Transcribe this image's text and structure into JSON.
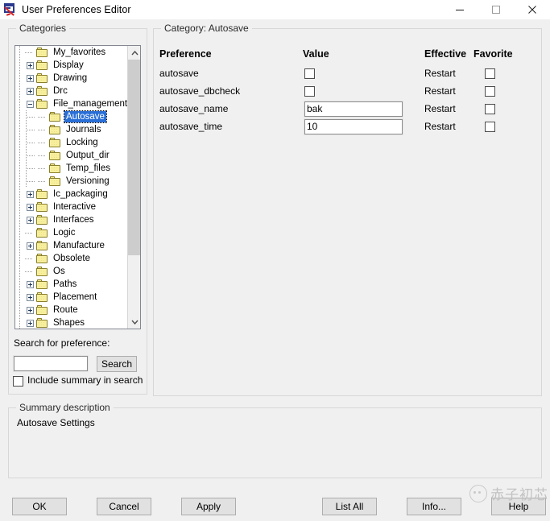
{
  "window": {
    "title": "User Preferences Editor",
    "icon": "app-icon",
    "buttons": {
      "minimize": "minimize-icon",
      "maximize": "maximize-icon",
      "close": "close-icon"
    }
  },
  "categories_panel": {
    "legend": "Categories",
    "tree": [
      {
        "label": "My_favorites",
        "indent": 1,
        "toggle": "none",
        "selected": false
      },
      {
        "label": "Display",
        "indent": 1,
        "toggle": "plus",
        "selected": false
      },
      {
        "label": "Drawing",
        "indent": 1,
        "toggle": "plus",
        "selected": false
      },
      {
        "label": "Drc",
        "indent": 1,
        "toggle": "plus",
        "selected": false
      },
      {
        "label": "File_management",
        "indent": 1,
        "toggle": "minus",
        "selected": false
      },
      {
        "label": "Autosave",
        "indent": 2,
        "toggle": "none",
        "selected": true
      },
      {
        "label": "Journals",
        "indent": 2,
        "toggle": "none",
        "selected": false
      },
      {
        "label": "Locking",
        "indent": 2,
        "toggle": "none",
        "selected": false
      },
      {
        "label": "Output_dir",
        "indent": 2,
        "toggle": "none",
        "selected": false
      },
      {
        "label": "Temp_files",
        "indent": 2,
        "toggle": "none",
        "selected": false
      },
      {
        "label": "Versioning",
        "indent": 2,
        "toggle": "none",
        "selected": false
      },
      {
        "label": "Ic_packaging",
        "indent": 1,
        "toggle": "plus",
        "selected": false
      },
      {
        "label": "Interactive",
        "indent": 1,
        "toggle": "plus",
        "selected": false
      },
      {
        "label": "Interfaces",
        "indent": 1,
        "toggle": "plus",
        "selected": false
      },
      {
        "label": "Logic",
        "indent": 1,
        "toggle": "none",
        "selected": false
      },
      {
        "label": "Manufacture",
        "indent": 1,
        "toggle": "plus",
        "selected": false
      },
      {
        "label": "Obsolete",
        "indent": 1,
        "toggle": "none",
        "selected": false
      },
      {
        "label": "Os",
        "indent": 1,
        "toggle": "none",
        "selected": false
      },
      {
        "label": "Paths",
        "indent": 1,
        "toggle": "plus",
        "selected": false
      },
      {
        "label": "Placement",
        "indent": 1,
        "toggle": "plus",
        "selected": false
      },
      {
        "label": "Route",
        "indent": 1,
        "toggle": "plus",
        "selected": false
      },
      {
        "label": "Shapes",
        "indent": 1,
        "toggle": "plus",
        "selected": false
      }
    ],
    "search": {
      "label": "Search for preference:",
      "value": "",
      "placeholder": "",
      "button": "Search",
      "include_summary_label": "Include summary in search",
      "include_summary_checked": false
    }
  },
  "preferences_panel": {
    "legend": "Category:   Autosave",
    "columns": [
      "Preference",
      "Value",
      "Effective",
      "Favorite"
    ],
    "rows": [
      {
        "name": "autosave",
        "value_type": "checkbox",
        "value": "",
        "checked": false,
        "effective": "Restart",
        "favorite": false
      },
      {
        "name": "autosave_dbcheck",
        "value_type": "checkbox",
        "value": "",
        "checked": false,
        "effective": "Restart",
        "favorite": false
      },
      {
        "name": "autosave_name",
        "value_type": "text",
        "value": "bak",
        "checked": false,
        "effective": "Restart",
        "favorite": false
      },
      {
        "name": "autosave_time",
        "value_type": "text",
        "value": "10",
        "checked": false,
        "effective": "Restart",
        "favorite": false
      }
    ]
  },
  "summary_panel": {
    "legend": "Summary description",
    "text": "Autosave Settings"
  },
  "footer": {
    "ok": "OK",
    "cancel": "Cancel",
    "apply": "Apply",
    "list_all": "List All",
    "info": "Info...",
    "help": "Help"
  },
  "watermark": {
    "text": "赤子初芯",
    "logo": "wechat-logo"
  },
  "colors": {
    "window_bg": "#f0f0f0",
    "titlebar_bg": "#ffffff",
    "field_bg": "#ffffff",
    "selection_blue": "#2a6fd6",
    "folder_yellow": "#f7ef9d",
    "button_face": "#e1e1e1",
    "scroll_thumb": "#cdcdcd"
  }
}
